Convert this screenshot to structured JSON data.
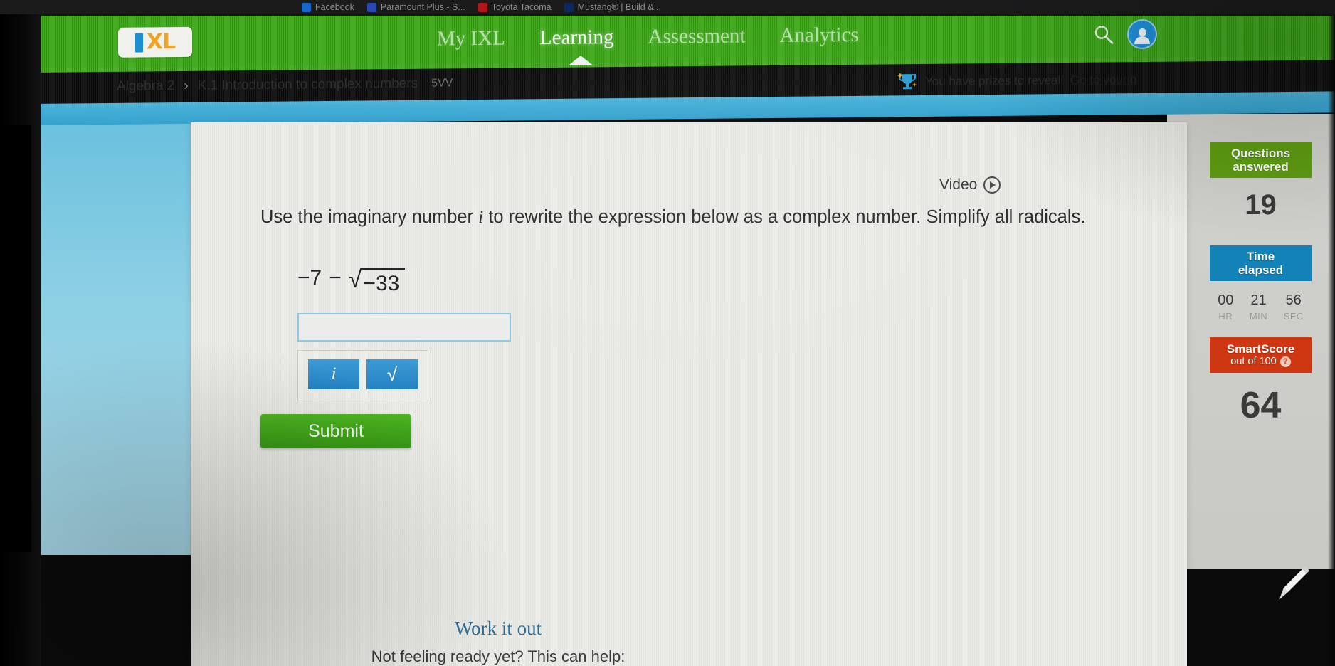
{
  "browser": {
    "tabs": [
      {
        "title": "Facebook",
        "favicon": "facebook-icon"
      },
      {
        "title": "Paramount Plus - S...",
        "favicon": "paramount-icon"
      },
      {
        "title": "Toyota Tacoma",
        "favicon": "toyota-icon"
      },
      {
        "title": "Mustang® | Build &...",
        "favicon": "ford-icon"
      }
    ]
  },
  "header": {
    "logo_text": "XL",
    "logo_name": "ixl-logo",
    "nav": [
      {
        "label": "My IXL",
        "active": false
      },
      {
        "label": "Learning",
        "active": true
      },
      {
        "label": "Assessment",
        "active": false
      },
      {
        "label": "Analytics",
        "active": false
      }
    ],
    "search_icon": "search-icon",
    "avatar_icon": "user-avatar-icon",
    "brand_green": "#3ba716"
  },
  "breadcrumb": {
    "course": "Algebra 2",
    "separator": "›",
    "skill": "K.1 Introduction to complex numbers",
    "skill_code": "5VV"
  },
  "prize_banner": {
    "icon": "trophy-icon",
    "text": "You have prizes to reveal!",
    "link_text": "Go to your g"
  },
  "question": {
    "video_label": "Video",
    "video_icon": "play-circle-icon",
    "prompt_part1": "Use the imaginary number ",
    "prompt_italic": "i",
    "prompt_part2": " to rewrite the expression below as a complex number. Simplify all radicals.",
    "expression": {
      "leading_term": "−7",
      "operator": "−",
      "radical_sign": "√",
      "radicand": "−33",
      "plain": "−7 − √(−33)"
    },
    "answer_value": "",
    "answer_placeholder": "",
    "keypad": [
      {
        "label": "i",
        "name": "keypad-i-button"
      },
      {
        "label": "√",
        "name": "keypad-sqrt-button"
      }
    ],
    "submit_label": "Submit"
  },
  "footer": {
    "work_it_out": "Work it out",
    "not_ready": "Not feeling ready yet? This can help:"
  },
  "stats": {
    "questions": {
      "title_line1": "Questions",
      "title_line2": "answered",
      "value": "19",
      "color": "#5f9d12"
    },
    "time": {
      "title_line1": "Time",
      "title_line2": "elapsed",
      "color": "#1282b8",
      "cells": [
        {
          "value": "00",
          "label": "HR"
        },
        {
          "value": "21",
          "label": "MIN"
        },
        {
          "value": "56",
          "label": "SEC"
        }
      ]
    },
    "smartscore": {
      "title_line1": "SmartScore",
      "title_line2": "out of 100",
      "help_icon": "question-mark-icon",
      "value": "64",
      "color": "#cf3713"
    }
  },
  "decor": {
    "pencil_icon": "pencil-icon"
  }
}
